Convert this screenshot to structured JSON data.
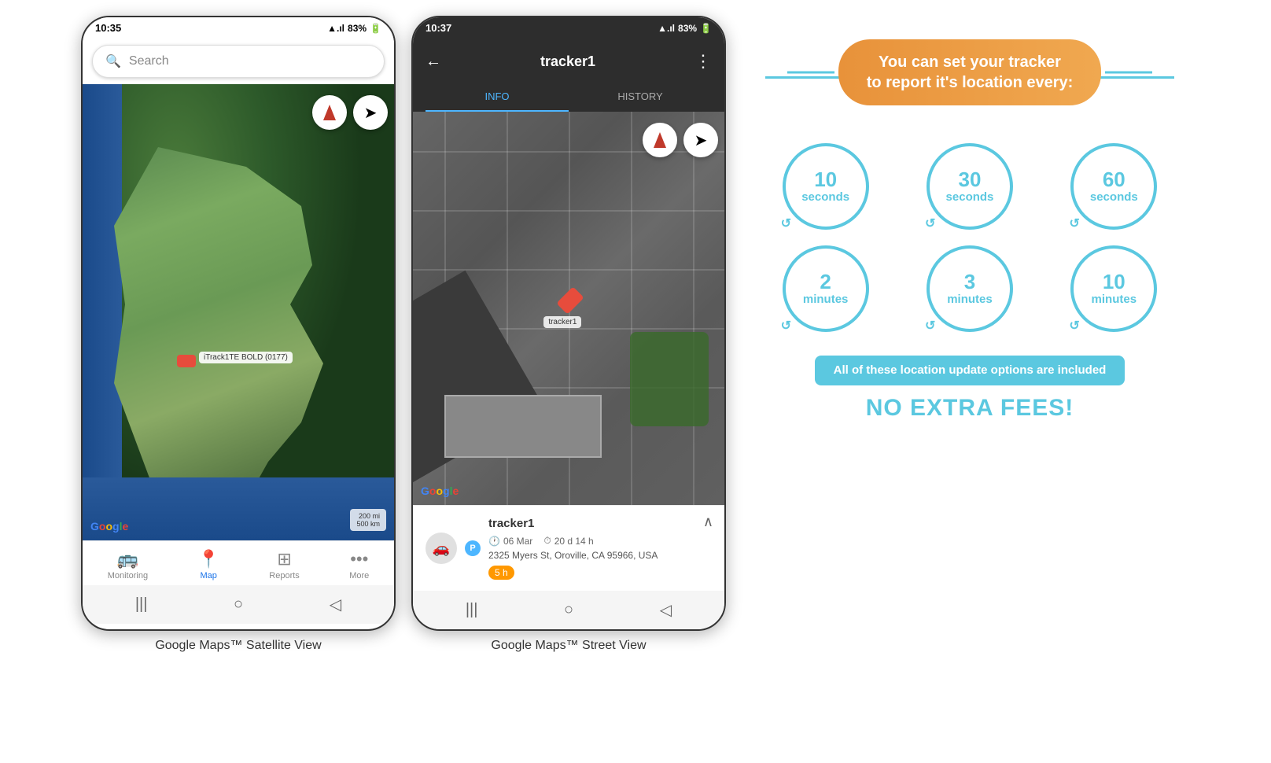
{
  "phone1": {
    "status_time": "10:35",
    "status_signal": "▲.ıl",
    "status_battery": "83%",
    "search_placeholder": "Search",
    "nav_items": [
      {
        "label": "Monitoring",
        "icon": "🚌",
        "active": false
      },
      {
        "label": "Map",
        "icon": "📍",
        "active": true
      },
      {
        "label": "Reports",
        "icon": "⊞",
        "active": false
      },
      {
        "label": "More",
        "icon": "•••",
        "active": false
      }
    ],
    "google_logo": "Google",
    "scale_label": "200 mi\n500 km",
    "tracker_label": "iTrack1TE BOLD (0177)",
    "caption": "Google Maps™ Satellite View"
  },
  "phone2": {
    "status_time": "10:37",
    "status_signal": "▲.ıl",
    "status_battery": "83%",
    "tracker_name": "tracker1",
    "tab_info": "INFO",
    "tab_history": "HISTORY",
    "google_logo": "Google",
    "tracker_label": "tracker1",
    "info": {
      "name": "tracker1",
      "p_badge": "P",
      "date": "06 Mar",
      "duration": "20 d 14 h",
      "address": "2325 Myers St, Oroville, CA 95966, USA",
      "time_badge": "5 h"
    },
    "caption": "Google Maps™ Street View"
  },
  "info_graphic": {
    "title_line1": "You can set your tracker",
    "title_line2": "to report it's location every:",
    "circles": [
      {
        "value": "10",
        "unit": "seconds"
      },
      {
        "value": "30",
        "unit": "seconds"
      },
      {
        "value": "60",
        "unit": "seconds"
      },
      {
        "value": "2",
        "unit": "minutes"
      },
      {
        "value": "3",
        "unit": "minutes"
      },
      {
        "value": "10",
        "unit": "minutes"
      }
    ],
    "included_text": "All of these location update options are included",
    "no_fees_text": "NO EXTRA FEES!",
    "accent_color": "#e8923a",
    "circle_color": "#5bc8e0"
  }
}
